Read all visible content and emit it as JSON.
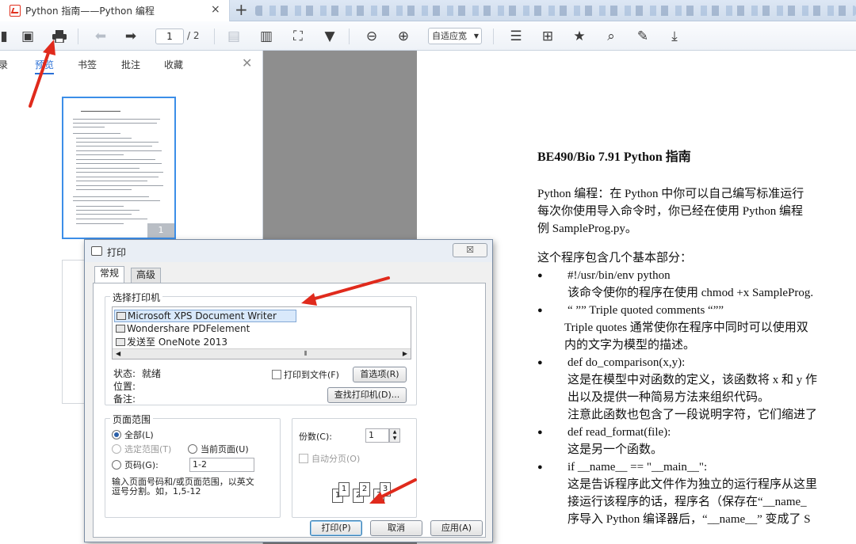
{
  "tab": {
    "title": "Python 指南——Python 编程",
    "close": "×",
    "new": "+"
  },
  "toolbar": {
    "page_current": "1",
    "page_total": "/ 2",
    "zoom": "自适应宽"
  },
  "sidebar": {
    "tabs": [
      {
        "label": "录"
      },
      {
        "label": "预览"
      },
      {
        "label": "书签"
      },
      {
        "label": "批注"
      },
      {
        "label": "收藏"
      }
    ],
    "close": "✕",
    "thumb_page": "1"
  },
  "document": {
    "title": "BE490/Bio 7.91 Python  指南",
    "intro": [
      "Python  编程：在 Python 中你可以自己编写标准运行",
      "每次你使用导入命令时，你已经在使用 Python 编程",
      "例 SampleProg.py。"
    ],
    "parts_intro": "这个程序包含几个基本部分：",
    "items": [
      {
        "bullet": "#!/usr/bin/env python",
        "desc": [
          "该命令使你的程序在使用 chmod +x SampleProg."
        ]
      },
      {
        "bullet": "“ ””   Triple quoted comments “””",
        "desc": [
          "Triple quotes 通常使你在程序中同时可以使用双",
          "内的文字为模型的描述。"
        ],
        "desc_style": "ind2"
      },
      {
        "bullet": "def do_comparison(x,y):",
        "desc": [
          "这是在模型中对函数的定义，该函数将 x 和 y 作",
          "出以及提供一种简易方法来组织代码。",
          "注意此函数也包含了一段说明字符，它们缩进了"
        ]
      },
      {
        "bullet": "def read_format(file):",
        "desc": [
          "这是另一个函数。"
        ]
      },
      {
        "bullet": "if __name__ == \"__main__\":",
        "desc": [
          "这是告诉程序此文件作为独立的运行程序从这里",
          "接运行该程序的话，程序名（保存在“__name_",
          "序导入 Python 编译器后，“__name__” 变成了 S"
        ]
      }
    ]
  },
  "dialog": {
    "title": "打印",
    "close": "☒",
    "tabs": [
      "常规",
      "高级"
    ],
    "select_printer_label": "选择打印机",
    "printers": [
      "Microsoft XPS Document Writer",
      "Wondershare PDFelement",
      "发送至 OneNote 2013"
    ],
    "status_label": "状态:",
    "status_value": "就绪",
    "location_label": "位置:",
    "comment_label": "备注:",
    "print_to_file": "打印到文件(F)",
    "preferences": "首选项(R)",
    "find_printer": "查找打印机(D)...",
    "page_range_label": "页面范围",
    "range_all": "全部(L)",
    "range_selection": "选定范围(T)",
    "range_current": "当前页面(U)",
    "range_pages": "页码(G):",
    "pages_value": "1-2",
    "range_hint": [
      "输入页面号码和/或页面范围，以英文",
      "逗号分割。如，1,5-12"
    ],
    "copies_label": "份数(C):",
    "copies_value": "1",
    "collate": "自动分页(O)",
    "collate_sheets": [
      "1",
      "1",
      "2",
      "2",
      "3",
      "3"
    ],
    "btn_print": "打印(P)",
    "btn_cancel": "取消",
    "btn_apply": "应用(A)"
  }
}
